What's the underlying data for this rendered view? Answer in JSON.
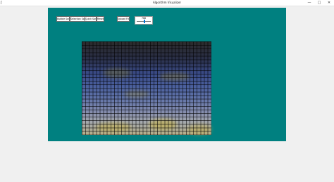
{
  "window": {
    "title": "Algorithm Visualizer",
    "controls": {
      "minimize": "—",
      "maximize": "□",
      "close": "✕"
    },
    "app_icon": "feather-icon"
  },
  "toolbar": {
    "bubble_sort_label": "Bubble Sort",
    "selection_sort_label": "Selection Sort",
    "quick_sort_label": "Quick Sort",
    "reset_label": "Reset",
    "upload_file_label": "Upload File",
    "speed_slider_value": "768"
  },
  "colors": {
    "canvas_background": "#008080",
    "window_background": "#f0f0f0",
    "grid_top": "#2b2b2b",
    "grid_middle": "#4a5f9d",
    "grid_bottom": "#b6b08a"
  },
  "grid": {
    "description_state": "pixel-block image grid",
    "rows": 26,
    "columns": 36
  }
}
